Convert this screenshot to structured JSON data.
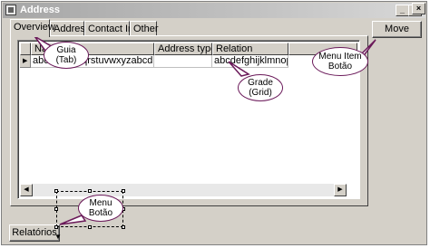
{
  "window": {
    "title": "Address"
  },
  "title_buttons": {
    "minimize": "_",
    "maximize": "□",
    "close": "×"
  },
  "tabs": [
    {
      "label": "Overview"
    },
    {
      "label": "Address"
    },
    {
      "label": "Contact Info"
    },
    {
      "label": "Other"
    }
  ],
  "grid": {
    "columns": [
      "Name",
      "",
      "Address type",
      "Relation"
    ],
    "rows": [
      {
        "indicator": "▶",
        "cells": [
          "abcd",
          "pqrstuvwxyzabcd",
          "",
          "abcdefghijklmnopqrs"
        ]
      }
    ]
  },
  "buttons": {
    "move": "Move",
    "relatorios": "Relatórios"
  },
  "callouts": {
    "guia": [
      "Guia",
      "(Tab)"
    ],
    "grade": [
      "Grade",
      "(Grid)"
    ],
    "menu_item_botao": [
      "Menu Item",
      "Botão"
    ],
    "menu_botao": [
      "Menu",
      "Botão"
    ]
  },
  "colors": {
    "callout_border": "#6b1a5a",
    "dialog_face": "#d4d0c8"
  }
}
